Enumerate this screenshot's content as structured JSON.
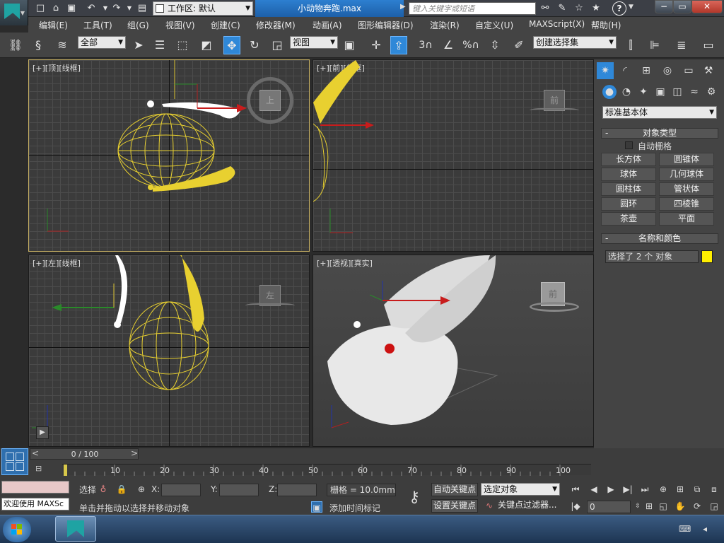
{
  "titlebar": {
    "workspace": "工作区: 默认",
    "file_title": "小动物奔跑.max",
    "search_placeholder": "键入关键字或短语",
    "help": "?"
  },
  "menu": [
    "编辑(E)",
    "工具(T)",
    "组(G)",
    "视图(V)",
    "创建(C)",
    "修改器(M)",
    "动画(A)",
    "图形编辑器(D)",
    "渲染(R)",
    "自定义(U)",
    "MAXScript(X)",
    "帮助(H)"
  ],
  "toolbar": {
    "filter": "全部",
    "refcoord": "视图",
    "named_selection": "创建选择集",
    "snap_3": "3",
    "snap_percent": "%"
  },
  "viewports": {
    "top": {
      "label": "[+][顶][线框]",
      "cube": "上"
    },
    "front": {
      "label": "[+][前][线框]",
      "cube": "前"
    },
    "left": {
      "label": "[+][左][线框]",
      "cube": "左"
    },
    "persp": {
      "label": "[+][透视][真实]",
      "cube": "前"
    }
  },
  "cmdpanel": {
    "dropdown": "标准基本体",
    "object_type_header": "对象类型",
    "autogrid": "自动栅格",
    "buttons": [
      "长方体",
      "圆锥体",
      "球体",
      "几何球体",
      "圆柱体",
      "管状体",
      "圆环",
      "四棱锥",
      "茶壶",
      "平面"
    ],
    "name_color_header": "名称和颜色",
    "selected_text": "选择了 2 个 对象",
    "object_color": "#ffee00"
  },
  "timeline": {
    "frame": "0 / 100",
    "ticks": [
      "10",
      "20",
      "30",
      "40",
      "50",
      "60",
      "70",
      "80",
      "90",
      "100"
    ],
    "progress": 0
  },
  "status": {
    "script_text": "欢迎使用 MAXSc",
    "select_label": "选择",
    "x_label": "X:",
    "y_label": "Y:",
    "z_label": "Z:",
    "grid": "栅格 = 10.0mm",
    "prompt": "单击并拖动以选择并移动对象",
    "add_time_tag": "添加时间标记",
    "auto_key": "自动关键点",
    "set_key": "设置关键点",
    "key_mode": "选定对象",
    "key_filters": "关键点过滤器...",
    "frame_value": "0"
  },
  "colors": {
    "accent": "#2f88d8",
    "selection": "#ffe25a",
    "wire_yellow": "#e8d030"
  }
}
